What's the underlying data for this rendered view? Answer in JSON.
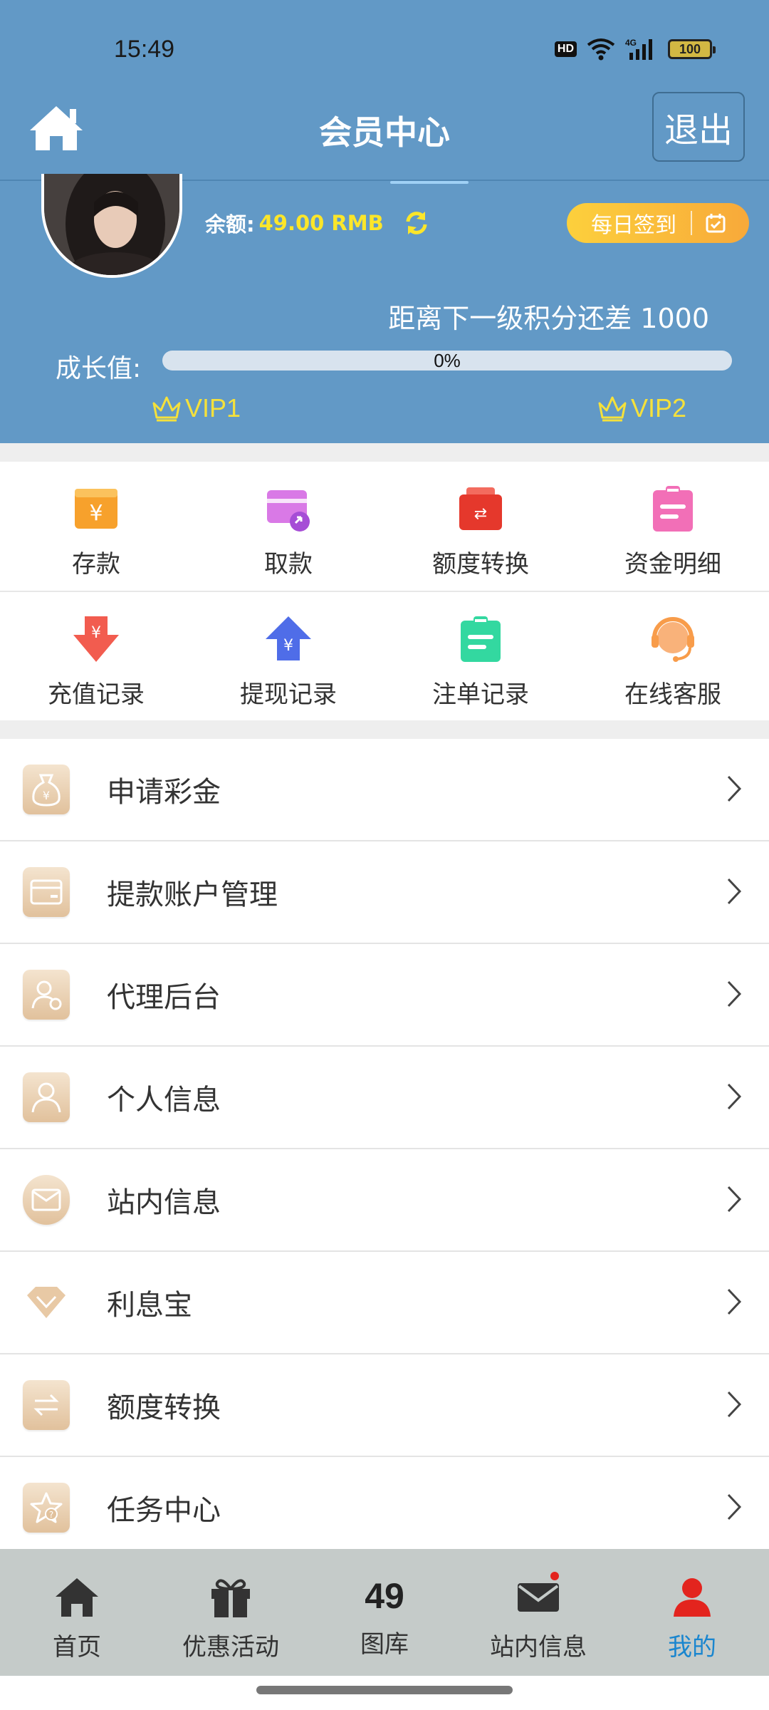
{
  "status_bar": {
    "time": "15:49",
    "hd": "HD",
    "network": "4G",
    "battery": "100"
  },
  "header": {
    "title": "会员中心",
    "logout": "退出"
  },
  "account": {
    "balance_label": "余额:",
    "balance_value": "49.00 RMB",
    "signin_label": "每日签到",
    "next_level_text": "距离下一级积分还差 1000",
    "growth_label": "成长值:",
    "progress_percent": 0,
    "progress_text": "0%",
    "vip_current": "VIP1",
    "vip_next": "VIP2"
  },
  "quick_actions": [
    {
      "label": "存款",
      "icon": "deposit-icon",
      "color": "#f7a12c"
    },
    {
      "label": "取款",
      "icon": "withdraw-icon",
      "color": "#c35ce9"
    },
    {
      "label": "额度转换",
      "icon": "transfer-wallet-icon",
      "color": "#e5382c"
    },
    {
      "label": "资金明细",
      "icon": "fund-detail-icon",
      "color": "#f26fb7"
    },
    {
      "label": "充值记录",
      "icon": "recharge-record-icon",
      "color": "#f25c4f"
    },
    {
      "label": "提现记录",
      "icon": "withdraw-record-icon",
      "color": "#4f6de8"
    },
    {
      "label": "注单记录",
      "icon": "bet-record-icon",
      "color": "#33d8a0"
    },
    {
      "label": "在线客服",
      "icon": "customer-service-icon",
      "color": "#f89c4a"
    }
  ],
  "menu": [
    {
      "label": "申请彩金",
      "icon": "money-bag-icon"
    },
    {
      "label": "提款账户管理",
      "icon": "bank-card-icon"
    },
    {
      "label": "代理后台",
      "icon": "agent-icon"
    },
    {
      "label": "个人信息",
      "icon": "user-icon"
    },
    {
      "label": "站内信息",
      "icon": "mail-icon"
    },
    {
      "label": "利息宝",
      "icon": "diamond-icon"
    },
    {
      "label": "额度转换",
      "icon": "swap-icon"
    },
    {
      "label": "任务中心",
      "icon": "task-star-icon"
    }
  ],
  "bottom_nav": [
    {
      "label": "首页",
      "icon": "home-icon"
    },
    {
      "label": "优惠活动",
      "icon": "gift-icon"
    },
    {
      "label": "图库",
      "number": "49"
    },
    {
      "label": "站内信息",
      "icon": "envelope-icon"
    },
    {
      "label": "我的",
      "icon": "profile-icon",
      "active": true
    }
  ],
  "colors": {
    "header_bg": "#6299c6",
    "accent_yellow": "#fbe62a",
    "active_nav": "#1a86cf",
    "signin_gradient_start": "#fcd03c",
    "signin_gradient_end": "#f8a93a"
  }
}
